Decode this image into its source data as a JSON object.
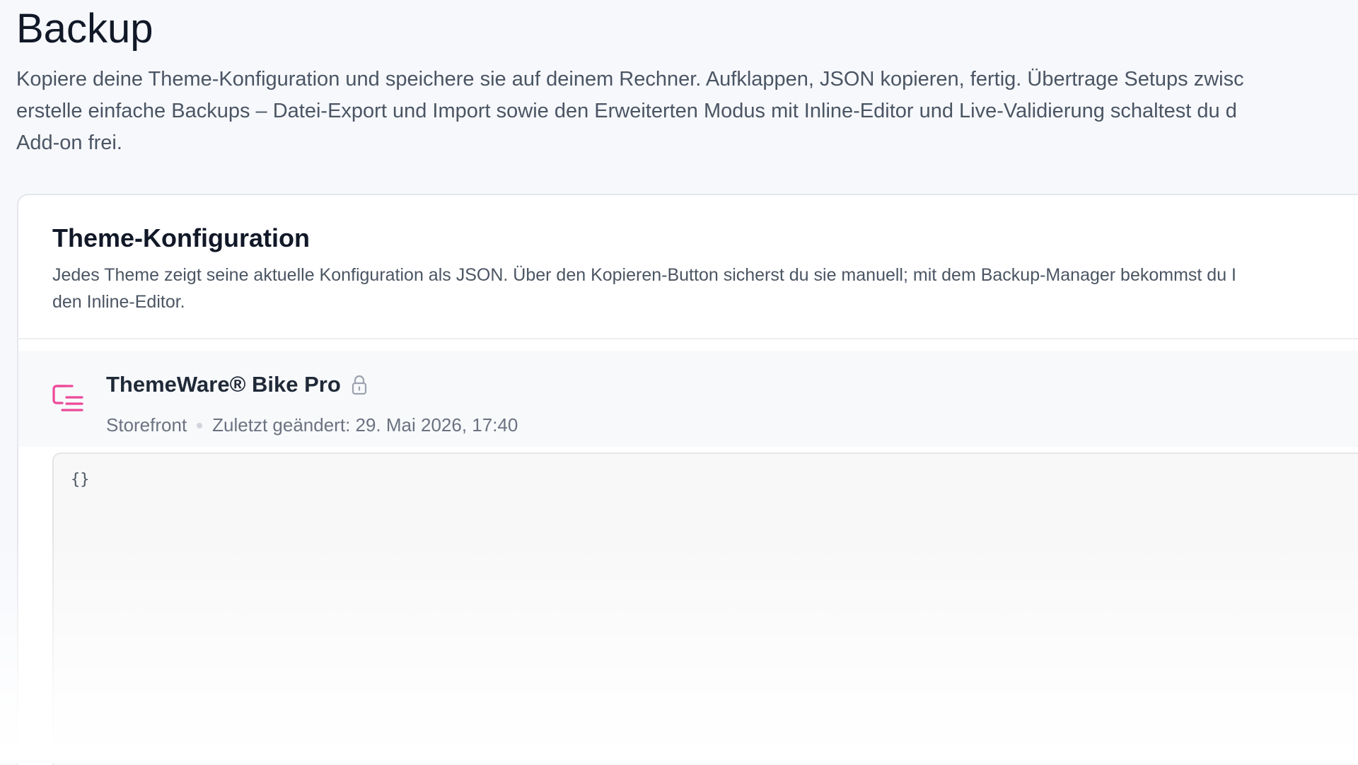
{
  "page": {
    "title": "Backup",
    "description_lines": [
      "Kopiere deine Theme-Konfiguration und speichere sie auf deinem Rechner. Aufklappen, JSON kopieren, fertig. Übertrage Setups zwisc",
      "erstelle einfache Backups – Datei-Export und Import sowie den Erweiterten Modus mit Inline-Editor und Live-Validierung schaltest du d",
      "Add-on frei."
    ]
  },
  "card": {
    "title": "Theme-Konfiguration",
    "description_lines": [
      "Jedes Theme zeigt seine aktuelle Konfiguration als JSON. Über den Kopieren-Button sicherst du sie manuell; mit dem Backup-Manager bekommst du I",
      "den Inline-Editor."
    ]
  },
  "theme": {
    "name": "ThemeWare® Bike Pro",
    "sales_channel": "Storefront",
    "last_changed": "Zuletzt geändert: 29. Mai 2026, 17:40",
    "icon": "config-list-icon",
    "lock_icon": "lock-icon",
    "accent_color": "#ec4899"
  },
  "json_editor": {
    "content": "{}"
  }
}
